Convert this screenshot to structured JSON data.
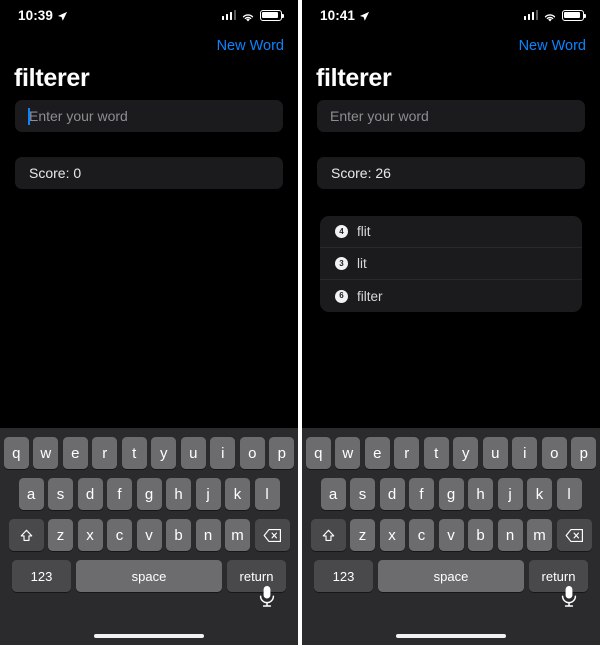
{
  "app": {
    "title": "filterer",
    "accent_color": "#0a84ff"
  },
  "screens": [
    {
      "id": "left",
      "status_bar": {
        "time": "10:39",
        "location_icon": "location-arrow-icon",
        "signal_icon": "cellular-signal-icon",
        "wifi_icon": "wifi-icon",
        "battery_icon": "battery-icon"
      },
      "nav": {
        "new_word_label": "New Word"
      },
      "title": "filterer",
      "word_input": {
        "placeholder": "Enter your word",
        "value": "",
        "focused": true
      },
      "score": {
        "text": "Score: 0",
        "value": 0
      },
      "used_words": []
    },
    {
      "id": "right",
      "status_bar": {
        "time": "10:41",
        "location_icon": "location-arrow-icon",
        "signal_icon": "cellular-signal-icon",
        "wifi_icon": "wifi-icon",
        "battery_icon": "battery-icon"
      },
      "nav": {
        "new_word_label": "New Word"
      },
      "title": "filterer",
      "word_input": {
        "placeholder": "Enter your word",
        "value": "",
        "focused": false
      },
      "score": {
        "text": "Score: 26",
        "value": 26
      },
      "used_words": [
        {
          "count": "4",
          "word": "flit"
        },
        {
          "count": "3",
          "word": "lit"
        },
        {
          "count": "6",
          "word": "filter"
        }
      ]
    }
  ],
  "keyboard": {
    "row1": [
      "q",
      "w",
      "e",
      "r",
      "t",
      "y",
      "u",
      "i",
      "o",
      "p"
    ],
    "row2": [
      "a",
      "s",
      "d",
      "f",
      "g",
      "h",
      "j",
      "k",
      "l"
    ],
    "row3": [
      "z",
      "x",
      "c",
      "v",
      "b",
      "n",
      "m"
    ],
    "shift_icon": "shift-arrow-icon",
    "backspace_icon": "backspace-delete-icon",
    "numbers_label": "123",
    "space_label": "space",
    "return_label": "return",
    "dictation_icon": "microphone-icon",
    "home_indicator": "home-indicator-bar"
  }
}
